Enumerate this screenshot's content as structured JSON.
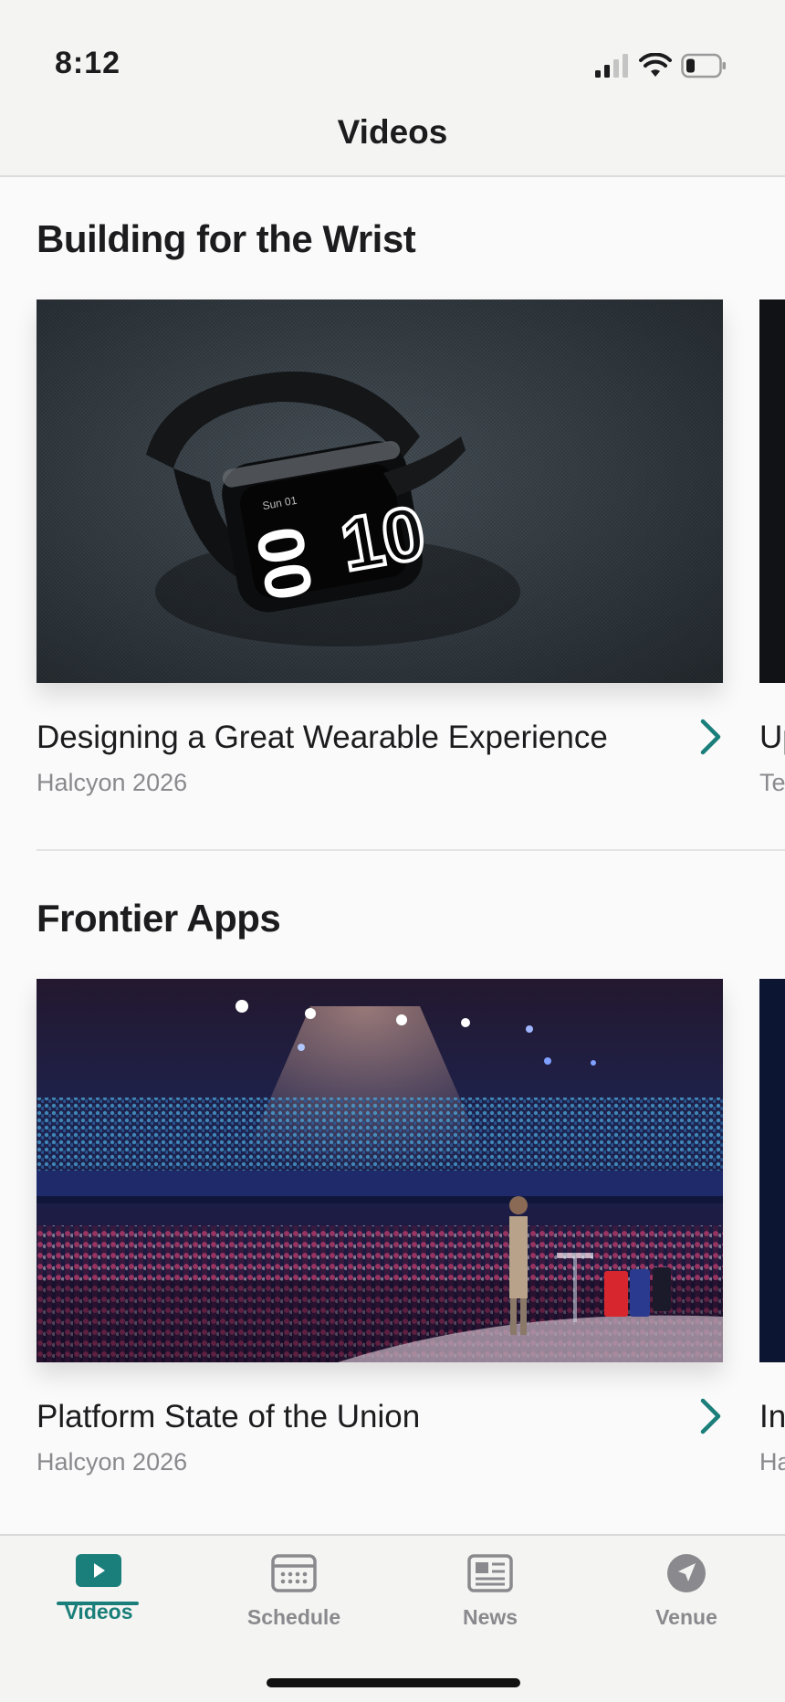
{
  "status_bar": {
    "time": "8:12"
  },
  "nav": {
    "title": "Videos"
  },
  "sections": [
    {
      "title": "Building for the Wrist",
      "card": {
        "title": "Designing a Great Wearable Experience",
        "subtitle": "Halcyon 2026",
        "image": "smartwatch-photo"
      },
      "peek": {
        "title": "Up",
        "subtitle": "Te"
      }
    },
    {
      "title": "Frontier Apps",
      "card": {
        "title": "Platform State of the Union",
        "subtitle": "Halcyon 2026",
        "image": "conference-stage-photo"
      },
      "peek": {
        "title": "In",
        "subtitle": "Ha"
      }
    }
  ],
  "tabs": [
    {
      "label": "Videos",
      "icon": "play-icon",
      "active": true
    },
    {
      "label": "Schedule",
      "icon": "calendar-icon",
      "active": false
    },
    {
      "label": "News",
      "icon": "newspaper-icon",
      "active": false
    },
    {
      "label": "Venue",
      "icon": "location-arrow-icon",
      "active": false
    }
  ],
  "colors": {
    "accent": "#1a7f7a",
    "inactive": "#8a8a8e",
    "background": "#fafafa",
    "bar": "#f4f4f2"
  }
}
